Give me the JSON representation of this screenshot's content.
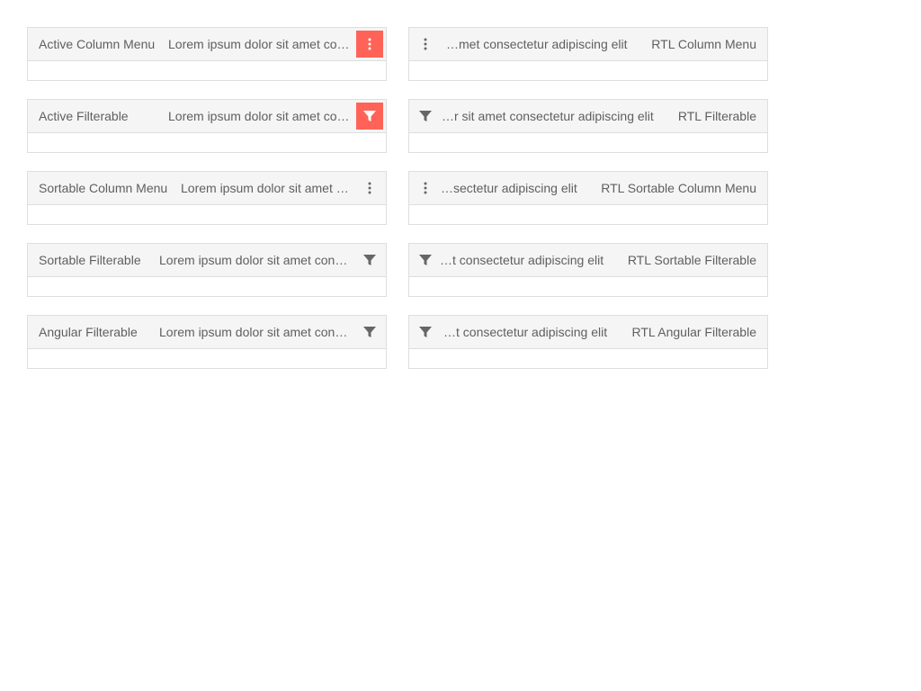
{
  "grids_left": [
    {
      "title": "Active Column Menu",
      "col2": "Lorem ipsum dolor sit amet consectetur adipiscing elit",
      "icon": "more-vertical-icon",
      "active": true
    },
    {
      "title": "Active Filterable",
      "col2": "Lorem ipsum dolor sit amet consectetur adipiscing elit",
      "icon": "filter-icon",
      "active": true
    },
    {
      "title": "Sortable Column Menu",
      "col2": "Lorem ipsum dolor sit amet consectetur adipiscing elit",
      "icon": "more-vertical-icon",
      "active": false
    },
    {
      "title": "Sortable Filterable",
      "col2": "Lorem ipsum dolor sit amet consectetur adipiscing elit",
      "icon": "filter-icon",
      "active": false
    },
    {
      "title": "Angular Filterable",
      "col2": "Lorem ipsum dolor sit amet consectetur adipiscing elit",
      "icon": "filter-icon",
      "active": false
    }
  ],
  "grids_right": [
    {
      "title": "RTL Column Menu",
      "col2": "…met consectetur adipiscing elit",
      "icon": "more-vertical-icon"
    },
    {
      "title": "RTL Filterable",
      "col2": "…r sit amet consectetur adipiscing elit",
      "icon": "filter-icon"
    },
    {
      "title": "RTL Sortable Column Menu",
      "col2": "…sectetur adipiscing elit",
      "icon": "more-vertical-icon"
    },
    {
      "title": "RTL Sortable Filterable",
      "col2": "…t consectetur adipiscing elit",
      "icon": "filter-icon"
    },
    {
      "title": "RTL Angular Filterable",
      "col2": "…t consectetur adipiscing elit",
      "icon": "filter-icon"
    }
  ],
  "colors": {
    "accent": "#ff6358",
    "header_bg": "#f5f5f5",
    "border": "#dedede",
    "text": "#5f5f5f"
  }
}
